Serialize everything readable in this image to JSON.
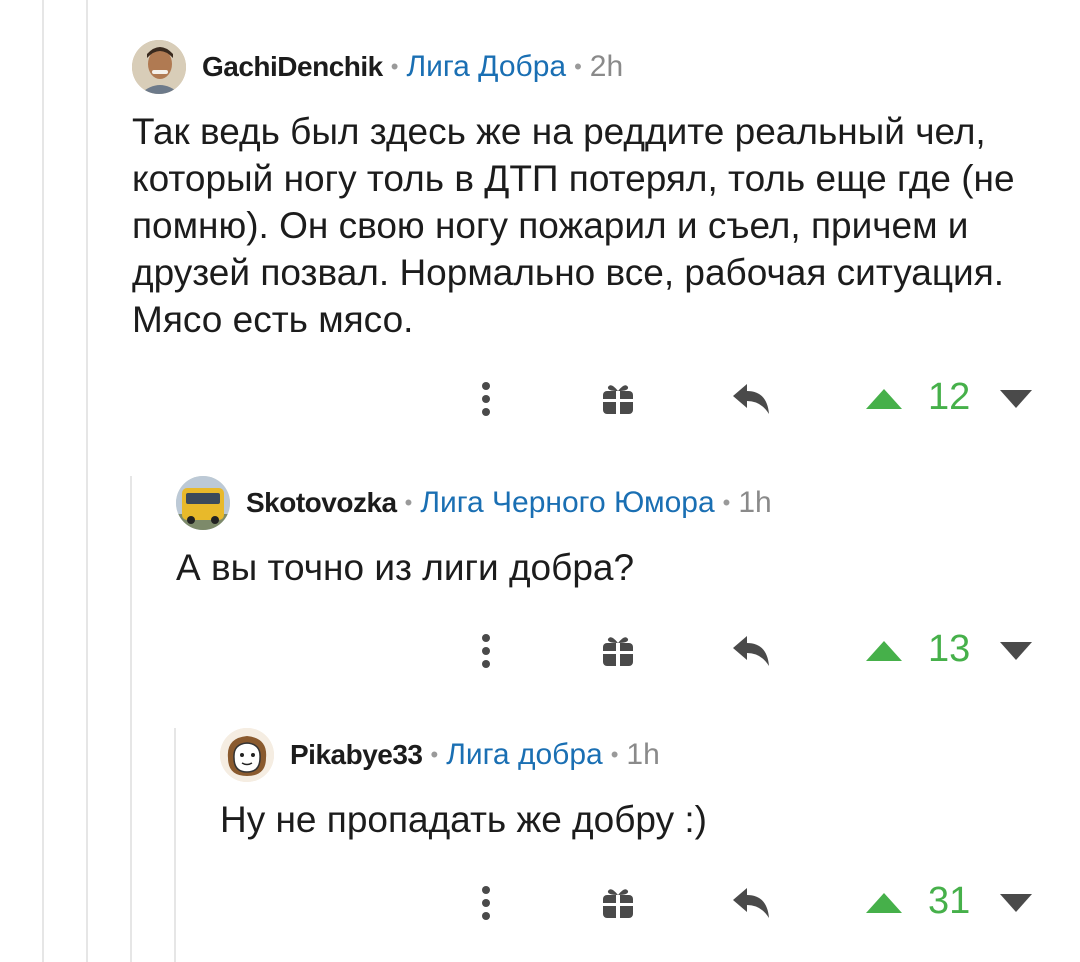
{
  "colors": {
    "accent_blue": "#1a6fb3",
    "upvote_green": "#46b04a",
    "icon_gray": "#4a4a4a",
    "thread_line": "#e6e6e6"
  },
  "comments": [
    {
      "author": "GachiDenchik",
      "community": "Лига Добра",
      "time": "2h",
      "text": "Так ведь был здесь же на реддите реальный чел, который ногу толь в ДТП потерял, толь еще где (не помню). Он свою ногу пожарил и съел, причем и друзей позвал. Нормально все, рабочая ситуация. Мясо есть мясо.",
      "score": "12",
      "avatar": "person-avatar"
    },
    {
      "author": "Skotovozka",
      "community": "Лига Черного Юмора",
      "time": "1h",
      "text": "А вы точно из лиги добра?",
      "score": "13",
      "avatar": "bus-avatar"
    },
    {
      "author": "Pikabye33",
      "community": "Лига добра",
      "time": "1h",
      "text": "Ну не пропадать же добру :)",
      "score": "31",
      "avatar": "cartoon-avatar"
    }
  ],
  "separator": "•",
  "icons": [
    "more-icon",
    "gift-icon",
    "reply-icon",
    "upvote-icon",
    "downvote-icon"
  ]
}
